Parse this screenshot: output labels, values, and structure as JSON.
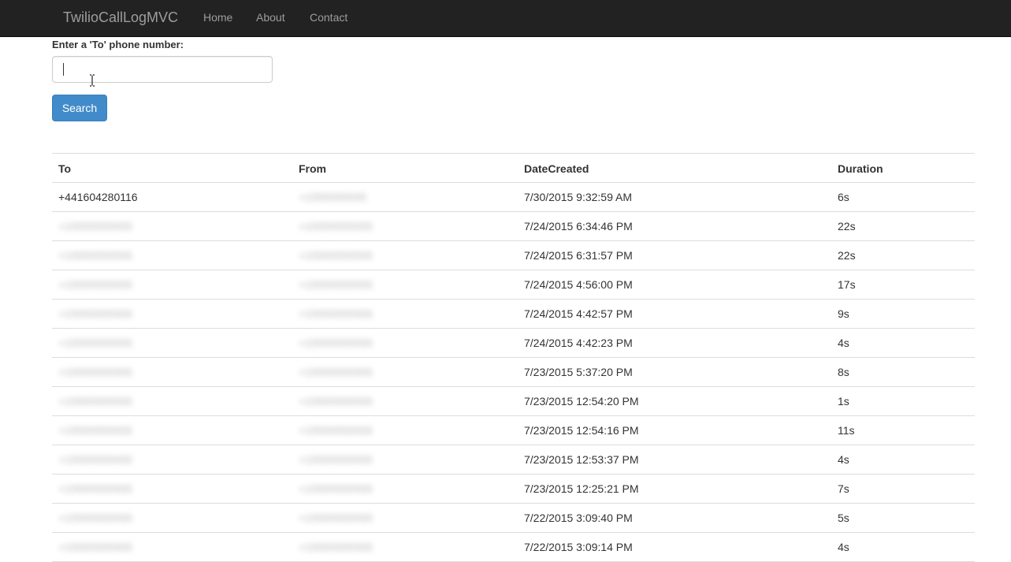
{
  "navbar": {
    "brand": "TwilioCallLogMVC",
    "links": [
      "Home",
      "About",
      "Contact"
    ]
  },
  "form": {
    "label": "Enter a 'To' phone number:",
    "to_value": "",
    "search_label": "Search"
  },
  "table": {
    "headers": [
      "To",
      "From",
      "DateCreated",
      "Duration"
    ],
    "rows": [
      {
        "to": "+441604280116",
        "from": "+1555555555",
        "date": "7/30/2015 9:32:59 AM",
        "duration": "6s"
      },
      {
        "to": "+15555555555",
        "from": "+15555555555",
        "date": "7/24/2015 6:34:46 PM",
        "duration": "22s"
      },
      {
        "to": "+15555555555",
        "from": "+15555555555",
        "date": "7/24/2015 6:31:57 PM",
        "duration": "22s"
      },
      {
        "to": "+15555555555",
        "from": "+15555555555",
        "date": "7/24/2015 4:56:00 PM",
        "duration": "17s"
      },
      {
        "to": "+15555555555",
        "from": "+15555555555",
        "date": "7/24/2015 4:42:57 PM",
        "duration": "9s"
      },
      {
        "to": "+15555555555",
        "from": "+15555555555",
        "date": "7/24/2015 4:42:23 PM",
        "duration": "4s"
      },
      {
        "to": "+15555555555",
        "from": "+15555555555",
        "date": "7/23/2015 5:37:20 PM",
        "duration": "8s"
      },
      {
        "to": "+15555555555",
        "from": "+15555555555",
        "date": "7/23/2015 12:54:20 PM",
        "duration": "1s"
      },
      {
        "to": "+15555555555",
        "from": "+15555555555",
        "date": "7/23/2015 12:54:16 PM",
        "duration": "11s"
      },
      {
        "to": "+15555555555",
        "from": "+15555555555",
        "date": "7/23/2015 12:53:37 PM",
        "duration": "4s"
      },
      {
        "to": "+15555555555",
        "from": "+15555555555",
        "date": "7/23/2015 12:25:21 PM",
        "duration": "7s"
      },
      {
        "to": "+15555555555",
        "from": "+15555555555",
        "date": "7/22/2015 3:09:40 PM",
        "duration": "5s"
      },
      {
        "to": "+15555555555",
        "from": "+15555555555",
        "date": "7/22/2015 3:09:14 PM",
        "duration": "4s"
      }
    ]
  }
}
